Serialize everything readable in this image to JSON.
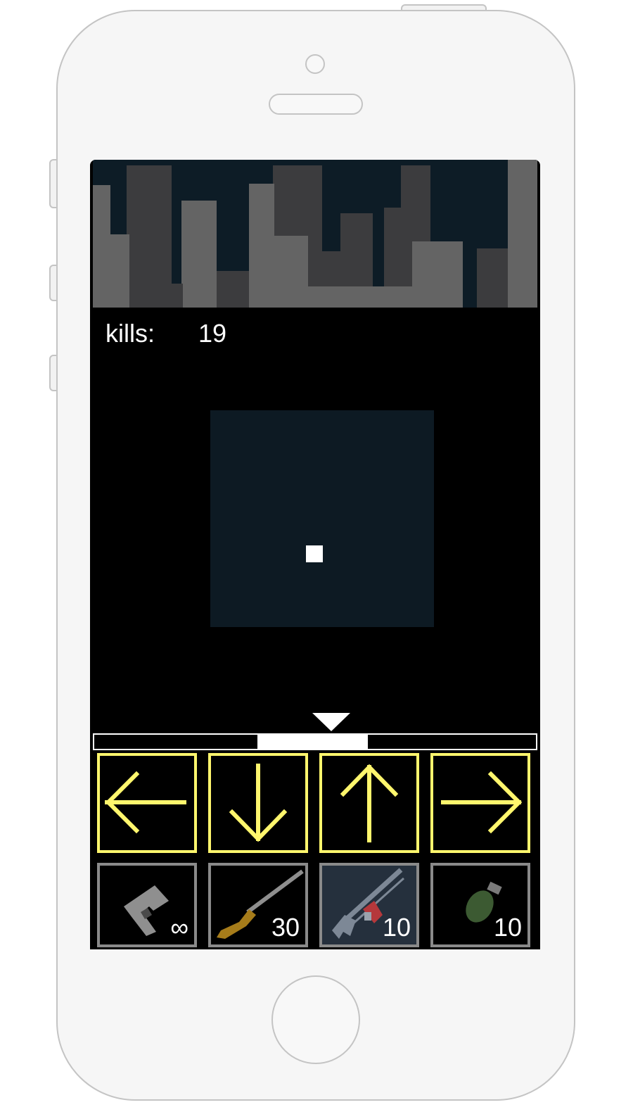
{
  "hud": {
    "kills_label": "kills:",
    "kills_value": "19"
  },
  "meter": {
    "marker_position": 0.54,
    "highlight_range": [
      0.37,
      0.62
    ]
  },
  "controls": [
    {
      "name": "left",
      "icon": "arrow-left-icon"
    },
    {
      "name": "down",
      "icon": "arrow-down-icon"
    },
    {
      "name": "up",
      "icon": "arrow-up-icon"
    },
    {
      "name": "right",
      "icon": "arrow-right-icon"
    }
  ],
  "weapons": [
    {
      "name": "pistol",
      "icon": "pistol-icon",
      "ammo": "∞",
      "selected": false
    },
    {
      "name": "shotgun",
      "icon": "shotgun-icon",
      "ammo": "30",
      "selected": false
    },
    {
      "name": "rocket-launcher",
      "icon": "rocket-launcher-icon",
      "ammo": "10",
      "selected": true
    },
    {
      "name": "grenade",
      "icon": "grenade-icon",
      "ammo": "10",
      "selected": false
    }
  ],
  "colors": {
    "control_border": "#fff66d",
    "weapon_border": "#8a8a8a",
    "selected_weapon_bg": "#25303d",
    "sky": "#0d1c26",
    "radar_bg": "#0d1a23"
  }
}
